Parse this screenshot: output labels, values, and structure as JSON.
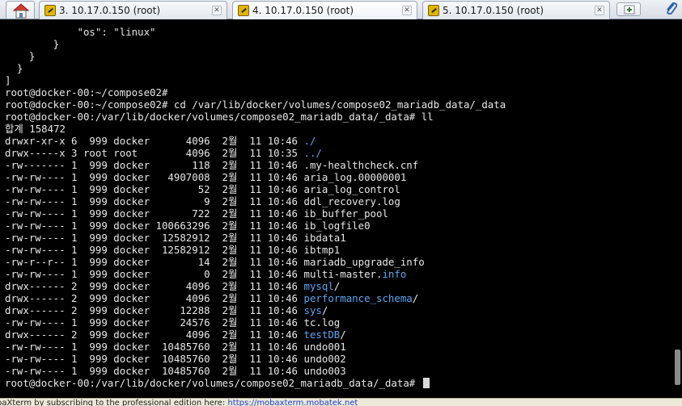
{
  "tabs": [
    {
      "label": "3. 10.17.0.150 (root)",
      "close": "✕"
    },
    {
      "label": "4. 10.17.0.150 (root)",
      "close": "✕"
    },
    {
      "label": "5. 10.17.0.150 (root)",
      "close": "✕"
    }
  ],
  "terminal": {
    "lines": [
      "            \"os\": \"linux\"",
      "        }",
      "    }",
      "  }",
      "]",
      "root@docker-00:~/compose02#",
      "root@docker-00:~/compose02# cd /var/lib/docker/volumes/compose02_mariadb_data/_data",
      "root@docker-00:/var/lib/docker/volumes/compose02_mariadb_data/_data# ll",
      "합계 158472"
    ],
    "listing": [
      {
        "meta": "drwxr-xr-x 6  999 docker      4096  2월  11 10:46 ",
        "name": "./",
        "blue": true,
        "suffix": ""
      },
      {
        "meta": "drwx-----x 3 root root        4096  2월  11 10:35 ",
        "name": "../",
        "blue": true,
        "suffix": ""
      },
      {
        "meta": "-rw------- 1  999 docker       118  2월  11 10:46 ",
        "name": ".my-healthcheck.cnf",
        "blue": false,
        "suffix": ""
      },
      {
        "meta": "-rw-rw---- 1  999 docker   4907008  2월  11 10:46 ",
        "name": "aria_log.00000001",
        "blue": false,
        "suffix": ""
      },
      {
        "meta": "-rw-rw---- 1  999 docker        52  2월  11 10:46 ",
        "name": "aria_log_control",
        "blue": false,
        "suffix": ""
      },
      {
        "meta": "-rw-rw---- 1  999 docker         9  2월  11 10:46 ",
        "name": "ddl_recovery.log",
        "blue": false,
        "suffix": ""
      },
      {
        "meta": "-rw-rw---- 1  999 docker       722  2월  11 10:46 ",
        "name": "ib_buffer_pool",
        "blue": false,
        "suffix": ""
      },
      {
        "meta": "-rw-rw---- 1  999 docker 100663296  2월  11 10:46 ",
        "name": "ib_logfile0",
        "blue": false,
        "suffix": ""
      },
      {
        "meta": "-rw-rw---- 1  999 docker  12582912  2월  11 10:46 ",
        "name": "ibdata1",
        "blue": false,
        "suffix": ""
      },
      {
        "meta": "-rw-rw---- 1  999 docker  12582912  2월  11 10:46 ",
        "name": "ibtmp1",
        "blue": false,
        "suffix": ""
      },
      {
        "meta": "-rw-r--r-- 1  999 docker        14  2월  11 10:46 ",
        "name": "mariadb_upgrade_info",
        "blue": false,
        "suffix": ""
      },
      {
        "meta": "-rw-rw---- 1  999 docker         0  2월  11 10:46 ",
        "name": "multi-master.",
        "blue": false,
        "suffix": "info"
      },
      {
        "meta": "drwx------ 2  999 docker      4096  2월  11 10:46 ",
        "name": "mysql",
        "blue": true,
        "suffix": "/"
      },
      {
        "meta": "drwx------ 2  999 docker      4096  2월  11 10:46 ",
        "name": "performance_schema",
        "blue": true,
        "suffix": "/"
      },
      {
        "meta": "drwx------ 2  999 docker     12288  2월  11 10:46 ",
        "name": "sys",
        "blue": true,
        "suffix": "/"
      },
      {
        "meta": "-rw-rw---- 1  999 docker     24576  2월  11 10:46 ",
        "name": "tc.log",
        "blue": false,
        "suffix": ""
      },
      {
        "meta": "drwx------ 2  999 docker      4096  2월  11 10:46 ",
        "name": "testDB",
        "blue": true,
        "suffix": "/"
      },
      {
        "meta": "-rw-rw---- 1  999 docker  10485760  2월  11 10:46 ",
        "name": "undo001",
        "blue": false,
        "suffix": ""
      },
      {
        "meta": "-rw-rw---- 1  999 docker  10485760  2월  11 10:46 ",
        "name": "undo002",
        "blue": false,
        "suffix": ""
      },
      {
        "meta": "-rw-rw---- 1  999 docker  10485760  2월  11 10:46 ",
        "name": "undo003",
        "blue": false,
        "suffix": ""
      }
    ],
    "prompt": "root@docker-00:/var/lib/docker/volumes/compose02_mariadb_data/_data# "
  },
  "statusbar": {
    "text": "baXterm by subscribing to the professional edition here: ",
    "link": "https://mobaxterm.mobatek.net"
  },
  "colors": {
    "dir_blue": "#5aa7f2",
    "terminal_bg": "#000000",
    "terminal_fg": "#e8e8e8"
  },
  "icons": [
    "home-icon",
    "terminal-tab-icon",
    "close-icon",
    "new-tab-icon",
    "paperclip-icon"
  ]
}
